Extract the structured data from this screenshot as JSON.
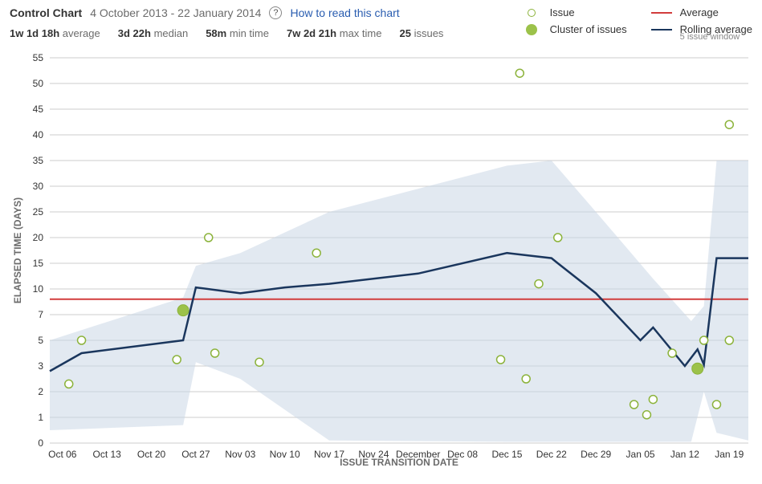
{
  "header": {
    "title": "Control Chart",
    "date_range": "4 October 2013 - 22 January 2014",
    "help_link": "How to read this chart"
  },
  "stats": {
    "average": {
      "value": "1w 1d 18h",
      "label": "average"
    },
    "median": {
      "value": "3d 22h",
      "label": "median"
    },
    "mintime": {
      "value": "58m",
      "label": "min time"
    },
    "maxtime": {
      "value": "7w 2d 21h",
      "label": "max time"
    },
    "issues": {
      "value": "25",
      "label": "issues"
    }
  },
  "legend": {
    "issue": "Issue",
    "cluster": "Cluster of issues",
    "average": "Average",
    "rolling": "Rolling average",
    "rolling_sub": "5 issue window"
  },
  "axes": {
    "x_label": "ISSUE TRANSITION DATE",
    "y_label": "ELAPSED TIME (DAYS)"
  },
  "chart_data": {
    "type": "scatter+line",
    "x_ticks": [
      "Oct 06",
      "Oct 13",
      "Oct 20",
      "Oct 27",
      "Nov 03",
      "Nov 10",
      "Nov 17",
      "Nov 24",
      "December",
      "Dec 08",
      "Dec 15",
      "Dec 22",
      "Dec 29",
      "Jan 05",
      "Jan 12",
      "Jan 19"
    ],
    "y_ticks": [
      0,
      1,
      2,
      3,
      5,
      7,
      10,
      15,
      20,
      25,
      30,
      35,
      40,
      45,
      50,
      55
    ],
    "ylim": [
      0,
      55
    ],
    "average_value": 8.8,
    "issues": [
      {
        "x": "Oct 07",
        "y": 2.3,
        "cluster": false
      },
      {
        "x": "Oct 09",
        "y": 5,
        "cluster": false
      },
      {
        "x": "Oct 24",
        "y": 3.5,
        "cluster": false
      },
      {
        "x": "Oct 25",
        "y": 7.5,
        "cluster": true
      },
      {
        "x": "Oct 29",
        "y": 20,
        "cluster": false
      },
      {
        "x": "Oct 30",
        "y": 4,
        "cluster": false
      },
      {
        "x": "Nov 06",
        "y": 3.3,
        "cluster": false
      },
      {
        "x": "Nov 15",
        "y": 17,
        "cluster": false
      },
      {
        "x": "Dec 14",
        "y": 3.5,
        "cluster": false
      },
      {
        "x": "Dec 17",
        "y": 52,
        "cluster": false
      },
      {
        "x": "Dec 18",
        "y": 2.5,
        "cluster": false
      },
      {
        "x": "Dec 20",
        "y": 11,
        "cluster": false
      },
      {
        "x": "Dec 23",
        "y": 20,
        "cluster": false
      },
      {
        "x": "Jan 04",
        "y": 1.5,
        "cluster": false
      },
      {
        "x": "Jan 06",
        "y": 1.1,
        "cluster": false
      },
      {
        "x": "Jan 07",
        "y": 1.7,
        "cluster": false
      },
      {
        "x": "Jan 10",
        "y": 4,
        "cluster": false
      },
      {
        "x": "Jan 14",
        "y": 2.9,
        "cluster": true
      },
      {
        "x": "Jan 15",
        "y": 5,
        "cluster": false
      },
      {
        "x": "Jan 17",
        "y": 1.5,
        "cluster": false
      },
      {
        "x": "Jan 19",
        "y": 5,
        "cluster": false
      },
      {
        "x": "Jan 19",
        "y": 42,
        "cluster": false
      }
    ],
    "rolling_average": [
      {
        "x": "Oct 04",
        "y": 2.8
      },
      {
        "x": "Oct 09",
        "y": 4.0
      },
      {
        "x": "Oct 25",
        "y": 5.0
      },
      {
        "x": "Oct 27",
        "y": 10.3
      },
      {
        "x": "Nov 03",
        "y": 9.5
      },
      {
        "x": "Nov 10",
        "y": 10.3
      },
      {
        "x": "Nov 17",
        "y": 11.0
      },
      {
        "x": "Dec 01",
        "y": 13.0
      },
      {
        "x": "Dec 15",
        "y": 17.0
      },
      {
        "x": "Dec 22",
        "y": 16.0
      },
      {
        "x": "Dec 23",
        "y": 15.0
      },
      {
        "x": "Dec 29",
        "y": 9.5
      },
      {
        "x": "Jan 05",
        "y": 5.0
      },
      {
        "x": "Jan 07",
        "y": 6.0
      },
      {
        "x": "Jan 12",
        "y": 3.0
      },
      {
        "x": "Jan 14",
        "y": 4.3
      },
      {
        "x": "Jan 15",
        "y": 3.1
      },
      {
        "x": "Jan 17",
        "y": 16.0
      },
      {
        "x": "Jan 22",
        "y": 16.0
      }
    ],
    "std_band": [
      {
        "x": "Oct 04",
        "lo": 0.5,
        "hi": 5.0
      },
      {
        "x": "Oct 25",
        "lo": 0.7,
        "hi": 9.0
      },
      {
        "x": "Oct 27",
        "lo": 3.3,
        "hi": 14.5
      },
      {
        "x": "Nov 03",
        "lo": 2.5,
        "hi": 17.0
      },
      {
        "x": "Nov 17",
        "lo": 0.1,
        "hi": 25.0
      },
      {
        "x": "Dec 15",
        "lo": 0.05,
        "hi": 34.0
      },
      {
        "x": "Dec 22",
        "lo": 0.05,
        "hi": 35.0
      },
      {
        "x": "Dec 29",
        "lo": 0.05,
        "hi": 25.0
      },
      {
        "x": "Jan 07",
        "lo": 0.05,
        "hi": 12.0
      },
      {
        "x": "Jan 13",
        "lo": 0.05,
        "hi": 6.5
      },
      {
        "x": "Jan 15",
        "lo": 2.0,
        "hi": 8.0
      },
      {
        "x": "Jan 17",
        "lo": 0.4,
        "hi": 35.0
      },
      {
        "x": "Jan 22",
        "lo": 0.1,
        "hi": 35.0
      }
    ],
    "x_domain_start": "Oct 04",
    "x_domain_end": "Jan 22"
  }
}
